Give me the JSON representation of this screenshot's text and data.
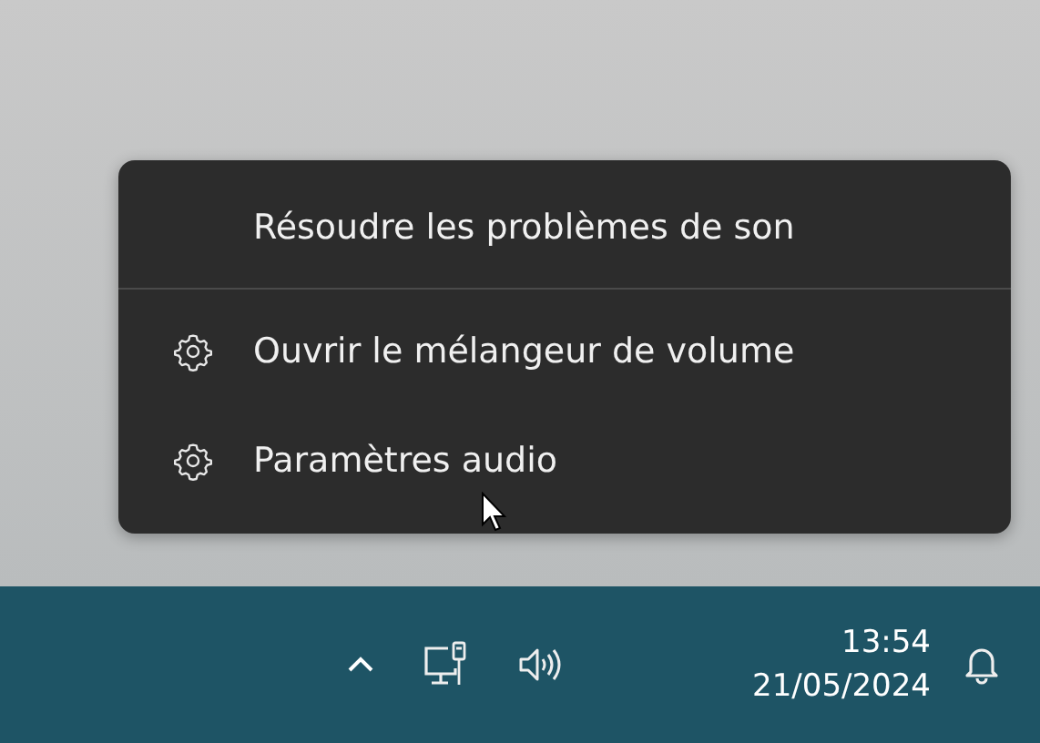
{
  "context_menu": {
    "items": [
      {
        "kind": "plain",
        "label": "Résoudre les problèmes de son"
      },
      {
        "kind": "separator"
      },
      {
        "kind": "gear",
        "label": "Ouvrir le mélangeur de volume"
      },
      {
        "kind": "gear",
        "label": "Paramètres audio"
      }
    ]
  },
  "taskbar": {
    "tray_icons": [
      {
        "kind": "chevron"
      },
      {
        "kind": "network"
      },
      {
        "kind": "speaker"
      }
    ],
    "time": "13:54",
    "date": "21/05/2024",
    "notification": {
      "kind": "bell"
    }
  }
}
